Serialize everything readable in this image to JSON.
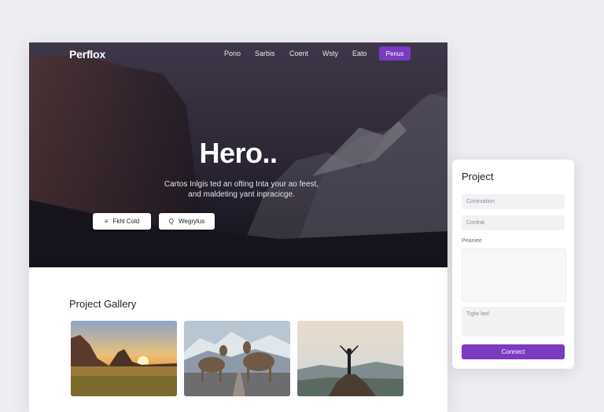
{
  "nav": {
    "logo": "Perflox",
    "links": [
      "Pono",
      "Sarbis",
      "Coent",
      "Wsty",
      "Eato"
    ],
    "cta": "Penus"
  },
  "hero": {
    "title": "Hero..",
    "subtitle_line1": "Cartos Inlgis ted an ofting Inta your ao feest,",
    "subtitle_line2": "and maldeting yant inpracicge.",
    "buttons": [
      {
        "icon": "list-icon",
        "glyph": "≡",
        "label": "Fkhl Cold"
      },
      {
        "icon": "search-icon",
        "glyph": "Q",
        "label": "Wegrylus"
      }
    ]
  },
  "gallery": {
    "title": "Project Gallery",
    "tiles": [
      {
        "name": "sunset-valley-image"
      },
      {
        "name": "goats-mountain-image"
      },
      {
        "name": "hiker-summit-image"
      }
    ]
  },
  "form": {
    "title": "Project",
    "field1_placeholder": "Contrsation",
    "field2_placeholder": "Contrat",
    "textarea_label": "Peaniee",
    "textarea2_placeholder": "Tiglw lanl",
    "submit": "Connect"
  },
  "colors": {
    "accent": "#7a3bc0",
    "hero_bg": "#2a2336"
  }
}
